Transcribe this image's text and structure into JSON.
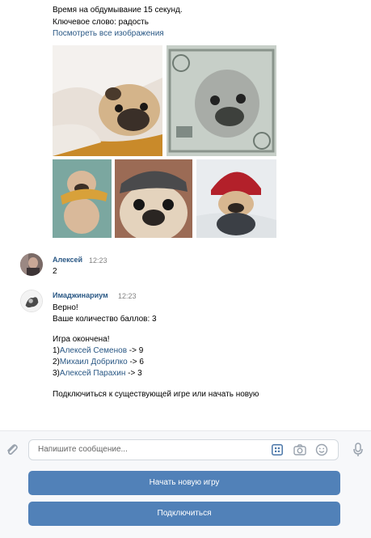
{
  "game_intro": {
    "think_time": "Время на обдумывание 15 секунд.",
    "keyword": "Ключевое слово: радость",
    "view_all": "Посмотреть все изображения"
  },
  "images": [
    "pug-in-blanket",
    "pug-on-dollar",
    "pug-with-toy",
    "pug-in-flat-cap",
    "pug-in-red-hat"
  ],
  "messages": [
    {
      "author": "Алексей",
      "time": "12:23",
      "text": "2"
    },
    {
      "author": "Имаджинариум",
      "time": "12:23",
      "lines": [
        "Верно!",
        "Ваше количество баллов: 3",
        "Игра окончена!"
      ],
      "results": [
        {
          "place": "1)",
          "name": "Алексей Семенов",
          "score": " -> 9"
        },
        {
          "place": "2)",
          "name": "Михаил Добрилко",
          "score": " -> 6"
        },
        {
          "place": "3)",
          "name": "Алексей Парахин",
          "score": " -> 3"
        }
      ],
      "footer": "Подключиться к существующей игре или начать новую"
    }
  ],
  "composer": {
    "placeholder": "Напишите сообщение...",
    "icons": [
      "paperclip-icon",
      "keyboard-icon",
      "camera-icon",
      "smile-icon",
      "microphone-icon"
    ]
  },
  "keyboard_buttons": [
    "Начать новую игру",
    "Подключиться"
  ],
  "colors": {
    "link": "#2a5885",
    "button": "#5181b8",
    "time": "#828282"
  }
}
